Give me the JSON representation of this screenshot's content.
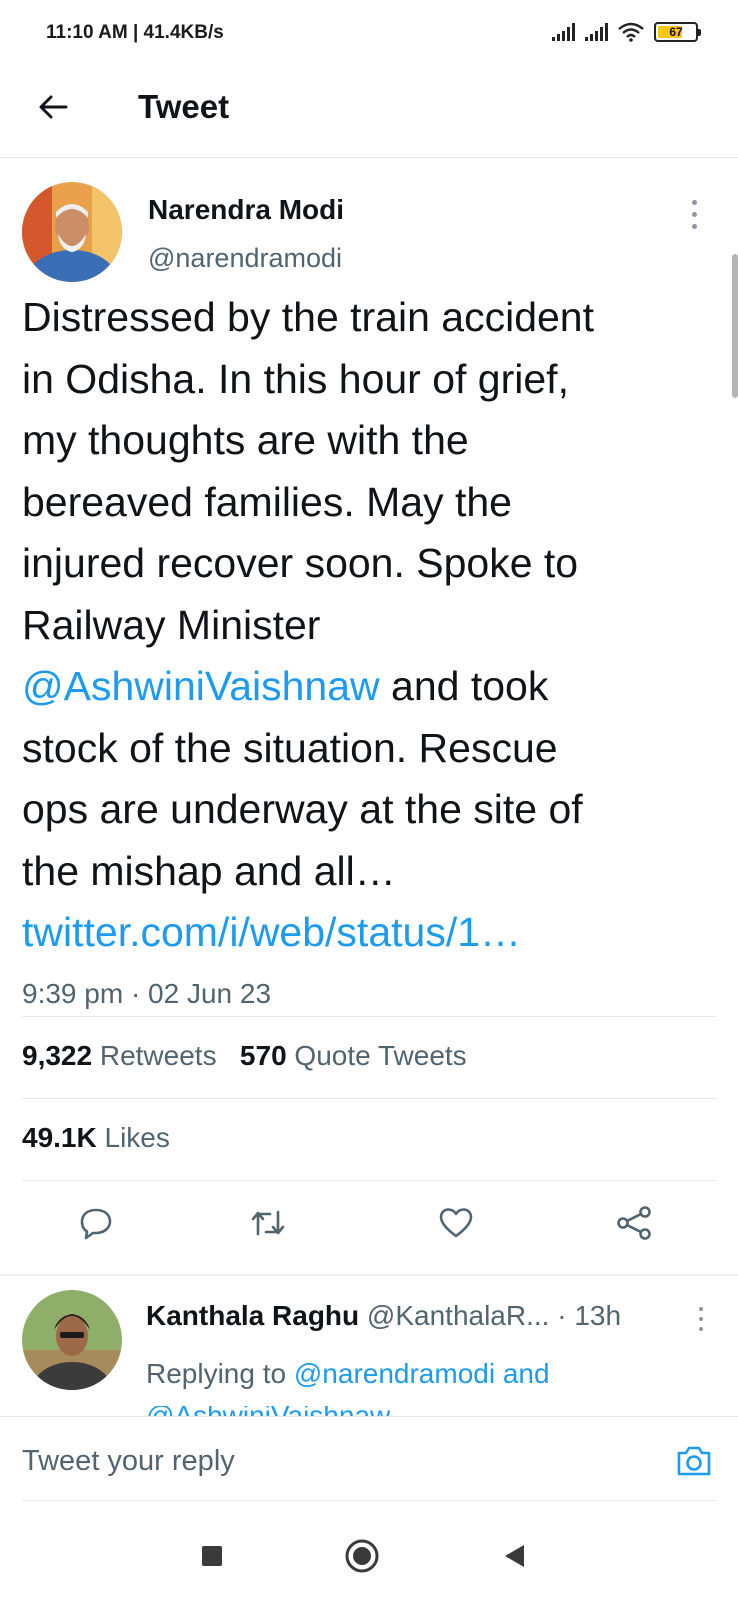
{
  "status_bar": {
    "time": "11:10 AM | 41.4KB/s",
    "battery_level": "67",
    "battery_percent": 67
  },
  "header": {
    "title": "Tweet"
  },
  "tweet": {
    "author_name": "Narendra Modi",
    "author_handle": "@narendramodi",
    "lines": [
      "Distressed by the train accident",
      "in Odisha. In this hour of grief,",
      "my thoughts are with the",
      "bereaved families. May the",
      "injured recover soon. Spoke to",
      "Railway Minister"
    ],
    "mention": "@AshwiniVaishnaw",
    "mention_suffix": " and took",
    "lines_after": [
      "stock of the situation. Rescue",
      "ops are underway at the site of",
      "the mishap and all…"
    ],
    "link": "twitter.com/i/web/status/1…",
    "timestamp": "9:39 pm · 02 Jun 23",
    "retweets_count": "9,322",
    "retweets_label": "Retweets",
    "quote_count": "570",
    "quote_label": "Quote Tweets",
    "likes_count": "49.1K",
    "likes_label": "Likes"
  },
  "reply": {
    "name": "Kanthala Raghu",
    "meta": "@KanthalaR... · 13h",
    "replying_prefix": "Replying to",
    "replying_to": "@narendramodi and",
    "cut_text": "@AshwiniVaishnaw"
  },
  "composer": {
    "placeholder": "Tweet your reply"
  },
  "icons": {
    "back": "arrow-left-icon",
    "reply": "comment-icon",
    "retweet": "retweet-icon",
    "like": "heart-icon",
    "share": "share-icon",
    "camera": "camera-icon"
  },
  "colors": {
    "link": "#1d9bf0",
    "text": "#0f1419",
    "secondary": "#536471"
  }
}
